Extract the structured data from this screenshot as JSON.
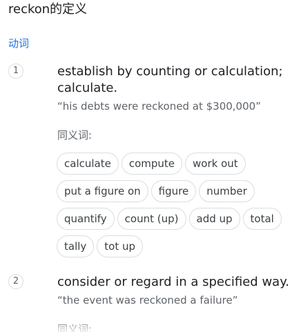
{
  "title": "reckon的定义",
  "part_of_speech": "动词",
  "senses": [
    {
      "number": "1",
      "definition": "establish by counting or calculation; calculate.",
      "example": "“his debts were reckoned at $300,000”",
      "synonyms_label": "同义词:",
      "synonym_rows": [
        [
          "calculate",
          "compute",
          "work out"
        ],
        [
          "put a figure on",
          "figure",
          "number"
        ],
        [
          "quantify",
          "count (up)",
          "add up",
          "total"
        ],
        [
          "tally",
          "tot up"
        ]
      ]
    },
    {
      "number": "2",
      "definition": "consider or regard in a specified way.",
      "example": "“the event was reckoned a failure”",
      "synonyms_label": "同义词:"
    }
  ]
}
